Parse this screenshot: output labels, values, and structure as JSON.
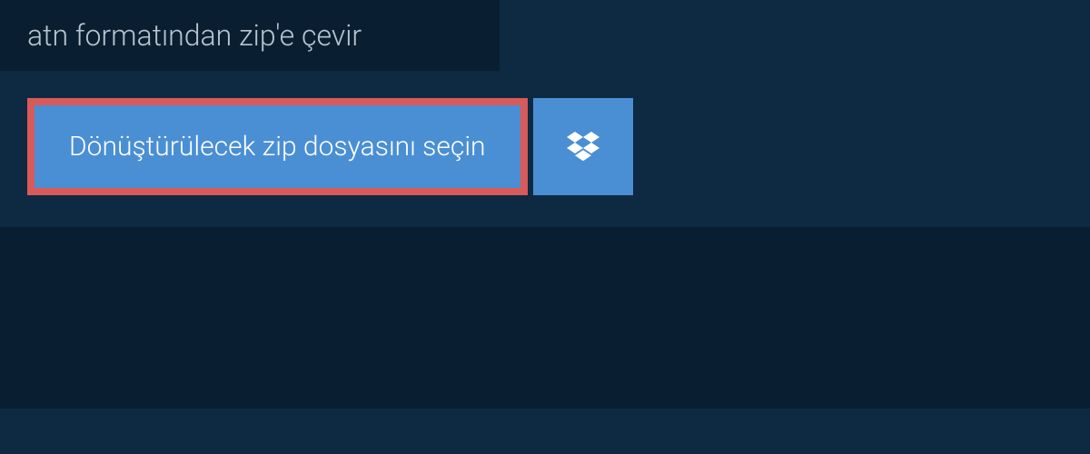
{
  "header": {
    "title": "atn formatından zip'e çevir"
  },
  "upload": {
    "select_file_label": "Dönüştürülecek zip dosyasını seçin",
    "dropbox_icon": "dropbox"
  }
}
